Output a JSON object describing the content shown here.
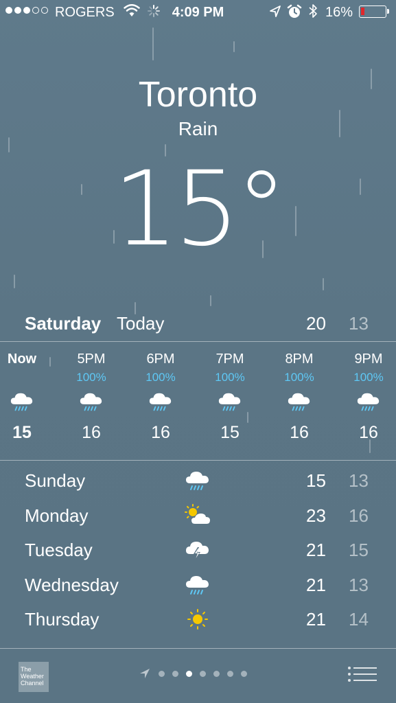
{
  "status_bar": {
    "signal_dots": [
      true,
      true,
      true,
      false,
      false
    ],
    "carrier": "ROGERS",
    "time": "4:09 PM",
    "battery_percent": "16%",
    "battery_level": 0.16,
    "battery_color": "#e0272b"
  },
  "header": {
    "city": "Toronto",
    "condition": "Rain",
    "temperature": "15°"
  },
  "today": {
    "day": "Saturday",
    "label": "Today",
    "high": "20",
    "low": "13"
  },
  "hourly": [
    {
      "time": "Now",
      "precip": "",
      "icon": "rain-cloud-icon",
      "temp": "15"
    },
    {
      "time": "5PM",
      "precip": "100%",
      "icon": "rain-cloud-icon",
      "temp": "16"
    },
    {
      "time": "6PM",
      "precip": "100%",
      "icon": "rain-cloud-icon",
      "temp": "16"
    },
    {
      "time": "7PM",
      "precip": "100%",
      "icon": "rain-cloud-icon",
      "temp": "15"
    },
    {
      "time": "8PM",
      "precip": "100%",
      "icon": "rain-cloud-icon",
      "temp": "16"
    },
    {
      "time": "9PM",
      "precip": "100%",
      "icon": "rain-cloud-icon",
      "temp": "16"
    }
  ],
  "daily": [
    {
      "day": "Sunday",
      "icon": "rain-cloud-icon",
      "high": "15",
      "low": "13"
    },
    {
      "day": "Monday",
      "icon": "partly-sunny-icon",
      "high": "23",
      "low": "16"
    },
    {
      "day": "Tuesday",
      "icon": "thunderstorm-icon",
      "high": "21",
      "low": "15"
    },
    {
      "day": "Wednesday",
      "icon": "rain-cloud-icon",
      "high": "21",
      "low": "13"
    },
    {
      "day": "Thursday",
      "icon": "sun-icon",
      "high": "21",
      "low": "14"
    }
  ],
  "bottom_bar": {
    "logo_text": "The Weather Channel",
    "page_count": 7,
    "active_page": 2
  },
  "colors": {
    "precip_blue": "#5ec8f5",
    "sun_yellow": "#f5c800"
  }
}
